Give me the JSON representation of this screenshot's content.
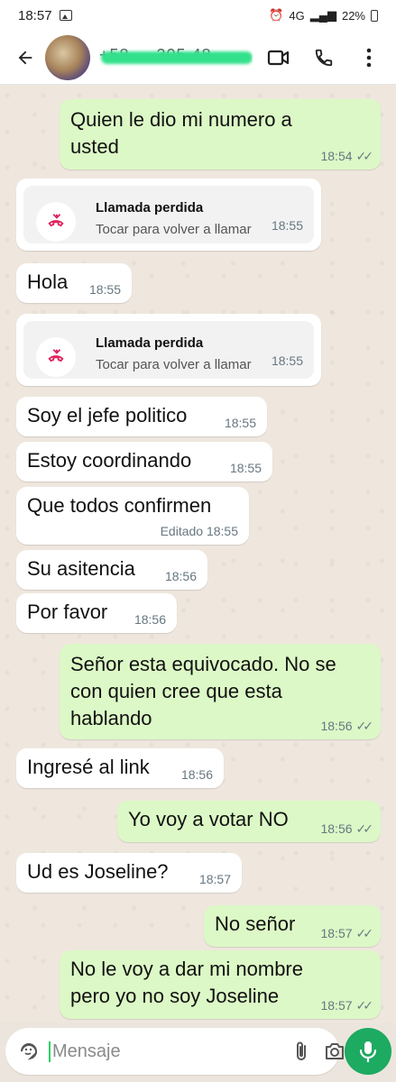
{
  "status_bar": {
    "time": "18:57",
    "network": "4G",
    "battery": "22%"
  },
  "header": {
    "contact_name": "+58 ... 305 48..."
  },
  "messages": [
    {
      "dir": "out",
      "text": "Quien le dio mi numero a usted",
      "time": "18:54",
      "read": true
    },
    {
      "dir": "in",
      "type": "missed_call",
      "title": "Llamada perdida",
      "subtitle": "Tocar para volver a llamar",
      "time": "18:55"
    },
    {
      "dir": "in",
      "text": "Hola",
      "time": "18:55"
    },
    {
      "dir": "in",
      "type": "missed_call",
      "title": "Llamada perdida",
      "subtitle": "Tocar para volver a llamar",
      "time": "18:55"
    },
    {
      "dir": "in",
      "text": "Soy el jefe politico",
      "time": "18:55"
    },
    {
      "dir": "in",
      "text": "Estoy coordinando",
      "time": "18:55"
    },
    {
      "dir": "in",
      "text": "Que todos confirmen",
      "time": "Editado 18:55"
    },
    {
      "dir": "in",
      "text": "Su asitencia",
      "time": "18:56"
    },
    {
      "dir": "in",
      "text": "Por favor",
      "time": "18:56"
    },
    {
      "dir": "out",
      "text": "Señor esta equivocado. No se con quien cree que esta hablando",
      "time": "18:56",
      "read": true
    },
    {
      "dir": "in",
      "text": "Ingresé al link",
      "time": "18:56"
    },
    {
      "dir": "out",
      "text": "Yo voy a votar NO",
      "time": "18:56",
      "read": true
    },
    {
      "dir": "in",
      "text": "Ud es Joseline?",
      "time": "18:57"
    },
    {
      "dir": "out",
      "text": "No señor",
      "time": "18:57",
      "read": true
    },
    {
      "dir": "out",
      "text": "No le voy a dar mi nombre pero yo no soy Joseline",
      "time": "18:57",
      "read": true
    }
  ],
  "input": {
    "placeholder": "Mensaje"
  },
  "colors": {
    "outgoing": "#dcf8c6",
    "incoming": "#ffffff",
    "accent": "#1daa61",
    "missed_call": "#e0245e"
  },
  "icons": [
    "back-arrow-icon",
    "video-call-icon",
    "phone-icon",
    "more-vert-icon",
    "missed-call-icon",
    "sticker-icon",
    "attach-icon",
    "camera-icon",
    "mic-icon"
  ]
}
